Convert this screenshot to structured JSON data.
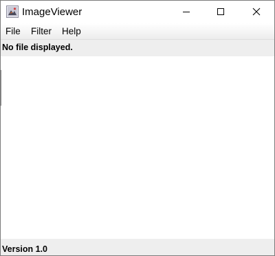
{
  "window": {
    "title": "ImageViewer",
    "icon": "java-app-icon",
    "controls": {
      "minimize": "minimize-icon",
      "maximize": "maximize-icon",
      "close": "close-icon"
    }
  },
  "menubar": {
    "items": [
      {
        "label": "File"
      },
      {
        "label": "Filter"
      },
      {
        "label": "Help"
      }
    ]
  },
  "file_label": "No file displayed.",
  "status": {
    "version": "Version 1.0"
  },
  "colors": {
    "panel_background": "#eeeeee",
    "content_background": "#ffffff"
  }
}
